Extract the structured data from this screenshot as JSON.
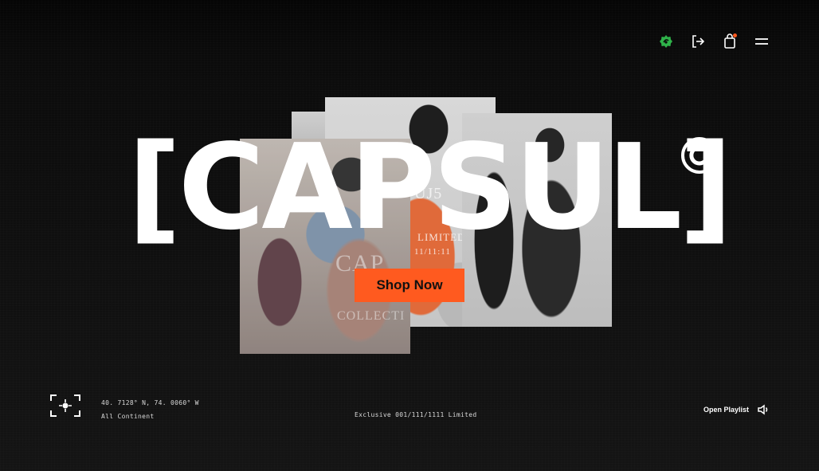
{
  "brand": {
    "title": "[CAPSUL]",
    "title_text": "CAPSUL",
    "bracket_open": "[",
    "bracket_close": "]",
    "copyright_symbol": "©"
  },
  "nav": {
    "icons": [
      "brand-badge-icon",
      "sign-out-icon",
      "shopping-bag-icon",
      "menu-icon"
    ],
    "accent_color": "#2fb24a"
  },
  "hero": {
    "cta_label": "Shop Now",
    "cta_color": "#ff5a1f",
    "photo_overlay_texts": [
      "CAP",
      "COLLECTI",
      "LIMITED",
      "11/11:11",
      "UJ5"
    ]
  },
  "footer": {
    "coordinates": "40. 7128° N, 74. 0060° W",
    "region": "All Continent",
    "exclusive_text": "Exclusive 001/111/1111 Limited",
    "playlist_label": "Open Playlist",
    "icons": [
      "locator-icon",
      "speaker-icon"
    ]
  }
}
